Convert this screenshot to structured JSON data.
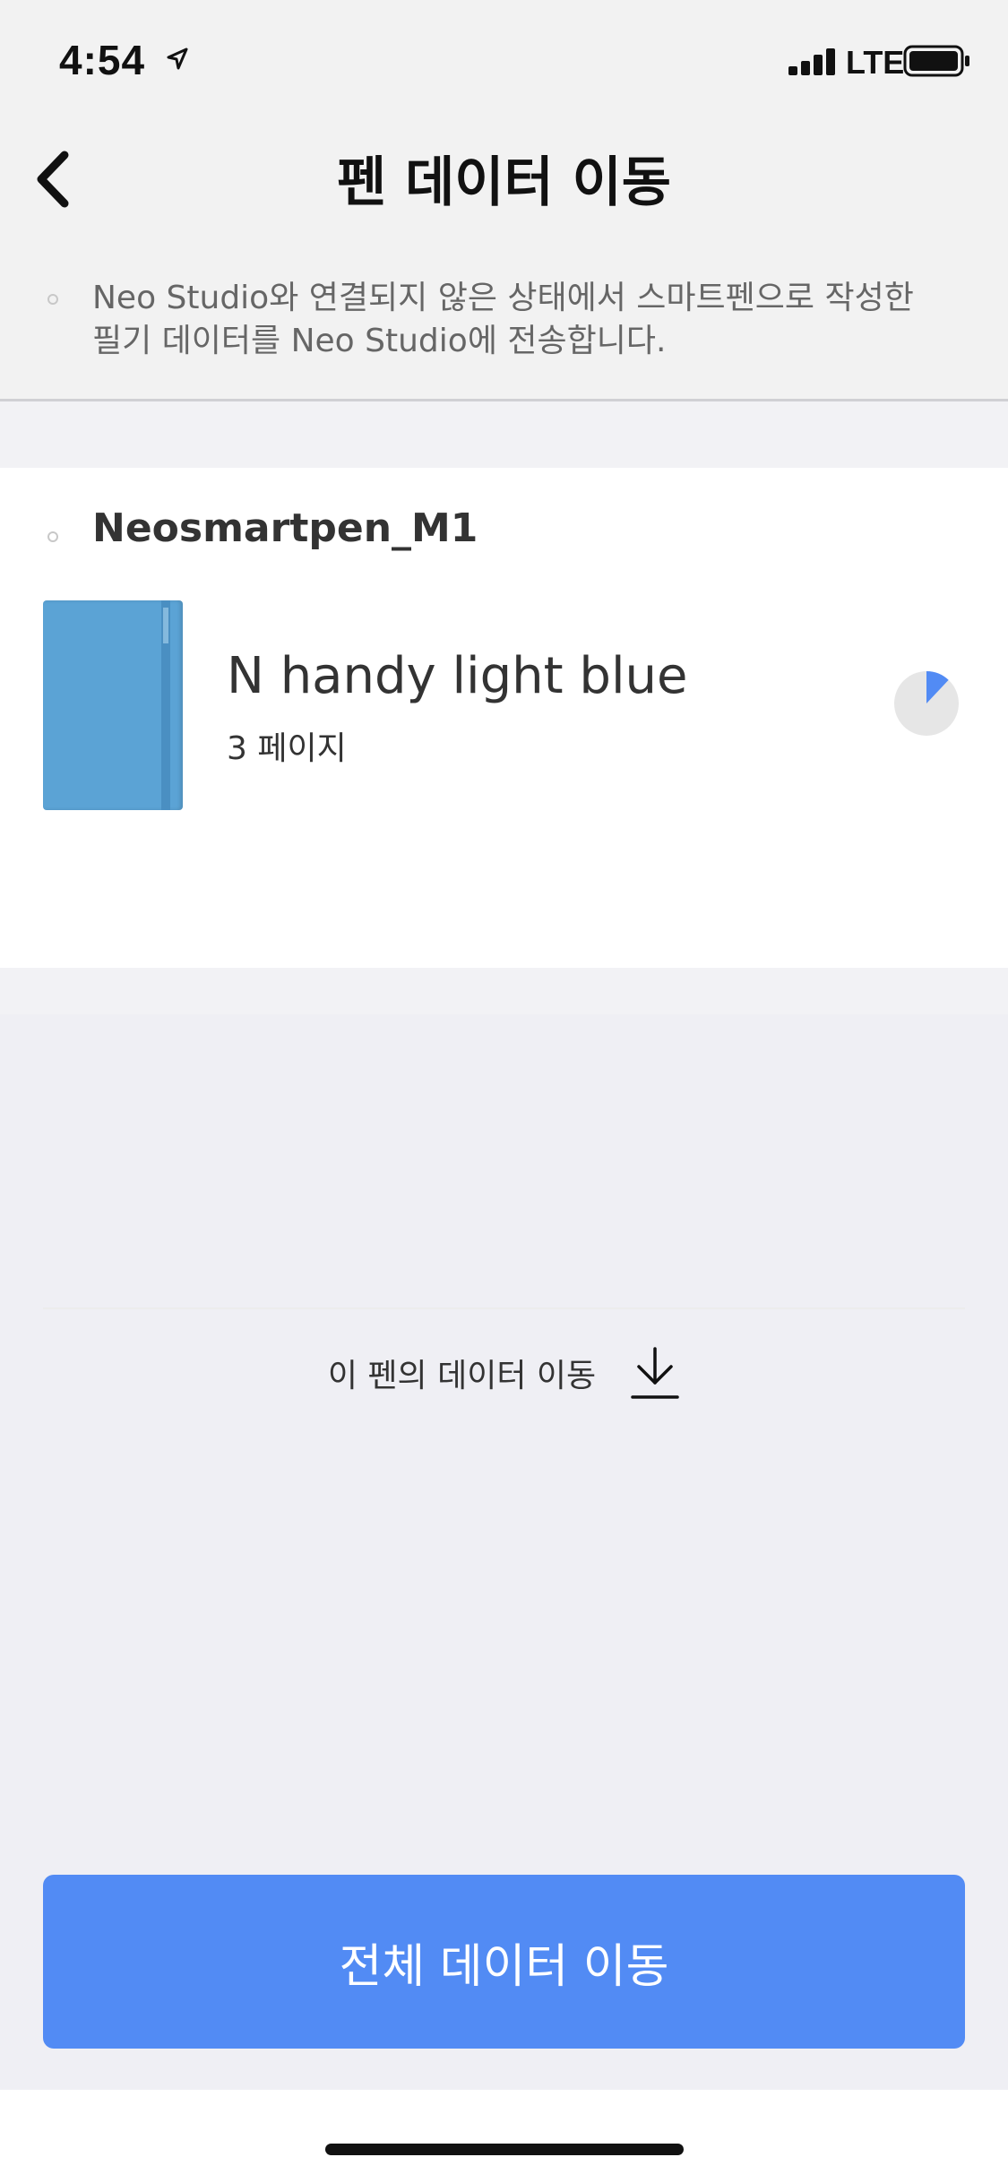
{
  "status_bar": {
    "time": "4:54",
    "network": "LTE"
  },
  "nav": {
    "title": "펜 데이터 이동"
  },
  "description": "Neo Studio와 연결되지 않은 상태에서 스마트펜으로 작성한 필기 데이터를 Neo Studio에 전송합니다.",
  "pen": {
    "name": "Neosmartpen_M1",
    "notebook": {
      "title": "N handy light blue",
      "pages": "3 페이지",
      "cover_color": "#5ba3d5",
      "progress": 0.12
    },
    "move_label": "이 펜의 데이터 이동"
  },
  "actions": {
    "transfer_all": "전체 데이터 이동"
  },
  "colors": {
    "accent": "#528bf4"
  }
}
